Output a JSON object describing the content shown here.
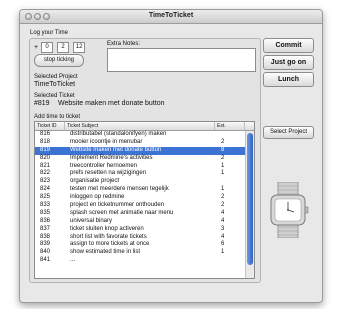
{
  "window": {
    "title": "TimeToTicket"
  },
  "timer": {
    "group_label": "Log your Time",
    "plus": "+",
    "hours": "0",
    "minutes": "2",
    "seconds": "12",
    "stop_label": "stop ticking",
    "notes_label": "Extra Notes:",
    "notes_value": ""
  },
  "selected_project": {
    "label": "Selected Project",
    "value": "TimeToTicket"
  },
  "selected_ticket": {
    "label": "Selected Ticket",
    "id": "#819",
    "subject": "Website maken met donate button"
  },
  "table": {
    "label": "Add time to ticket",
    "headers": [
      "Ticket ID",
      "Ticket Subject",
      "Est."
    ],
    "selected_index": 2,
    "rows": [
      {
        "id": "816",
        "subject": "distributabel (standalonifyen) maken",
        "est": ""
      },
      {
        "id": "818",
        "subject": "mooier icoontje in menubar",
        "est": "2"
      },
      {
        "id": "819",
        "subject": "Website maken met donate button",
        "est": "8"
      },
      {
        "id": "820",
        "subject": "Implement Redmine's activities",
        "est": "2"
      },
      {
        "id": "821",
        "subject": "treecontroller hernoemen",
        "est": "1"
      },
      {
        "id": "822",
        "subject": "prefs resetten na wijzigingen",
        "est": "1"
      },
      {
        "id": "823",
        "subject": "organisatie project",
        "est": ""
      },
      {
        "id": "824",
        "subject": "testen met meerdere mensen tegelijk",
        "est": "1"
      },
      {
        "id": "825",
        "subject": "inloggen op redmine",
        "est": "2"
      },
      {
        "id": "833",
        "subject": "project en ticketnummer onthouden",
        "est": "2"
      },
      {
        "id": "835",
        "subject": "splash screen met animatie naar menu",
        "est": "4"
      },
      {
        "id": "836",
        "subject": "universal binary",
        "est": "4"
      },
      {
        "id": "837",
        "subject": "ticket sluiten knop activeren",
        "est": "3"
      },
      {
        "id": "838",
        "subject": "short list with favorate tickets",
        "est": "4"
      },
      {
        "id": "839",
        "subject": "assign to more tickets at once",
        "est": "6"
      },
      {
        "id": "840",
        "subject": "show estimated time in list",
        "est": "1"
      },
      {
        "id": "841",
        "subject": "...",
        "est": ""
      }
    ]
  },
  "actions": {
    "commit": "Commit",
    "just_go_on": "Just go on",
    "lunch": "Lunch",
    "select_project": "Select Project"
  },
  "icons": {
    "watch": "wristwatch-icon"
  }
}
